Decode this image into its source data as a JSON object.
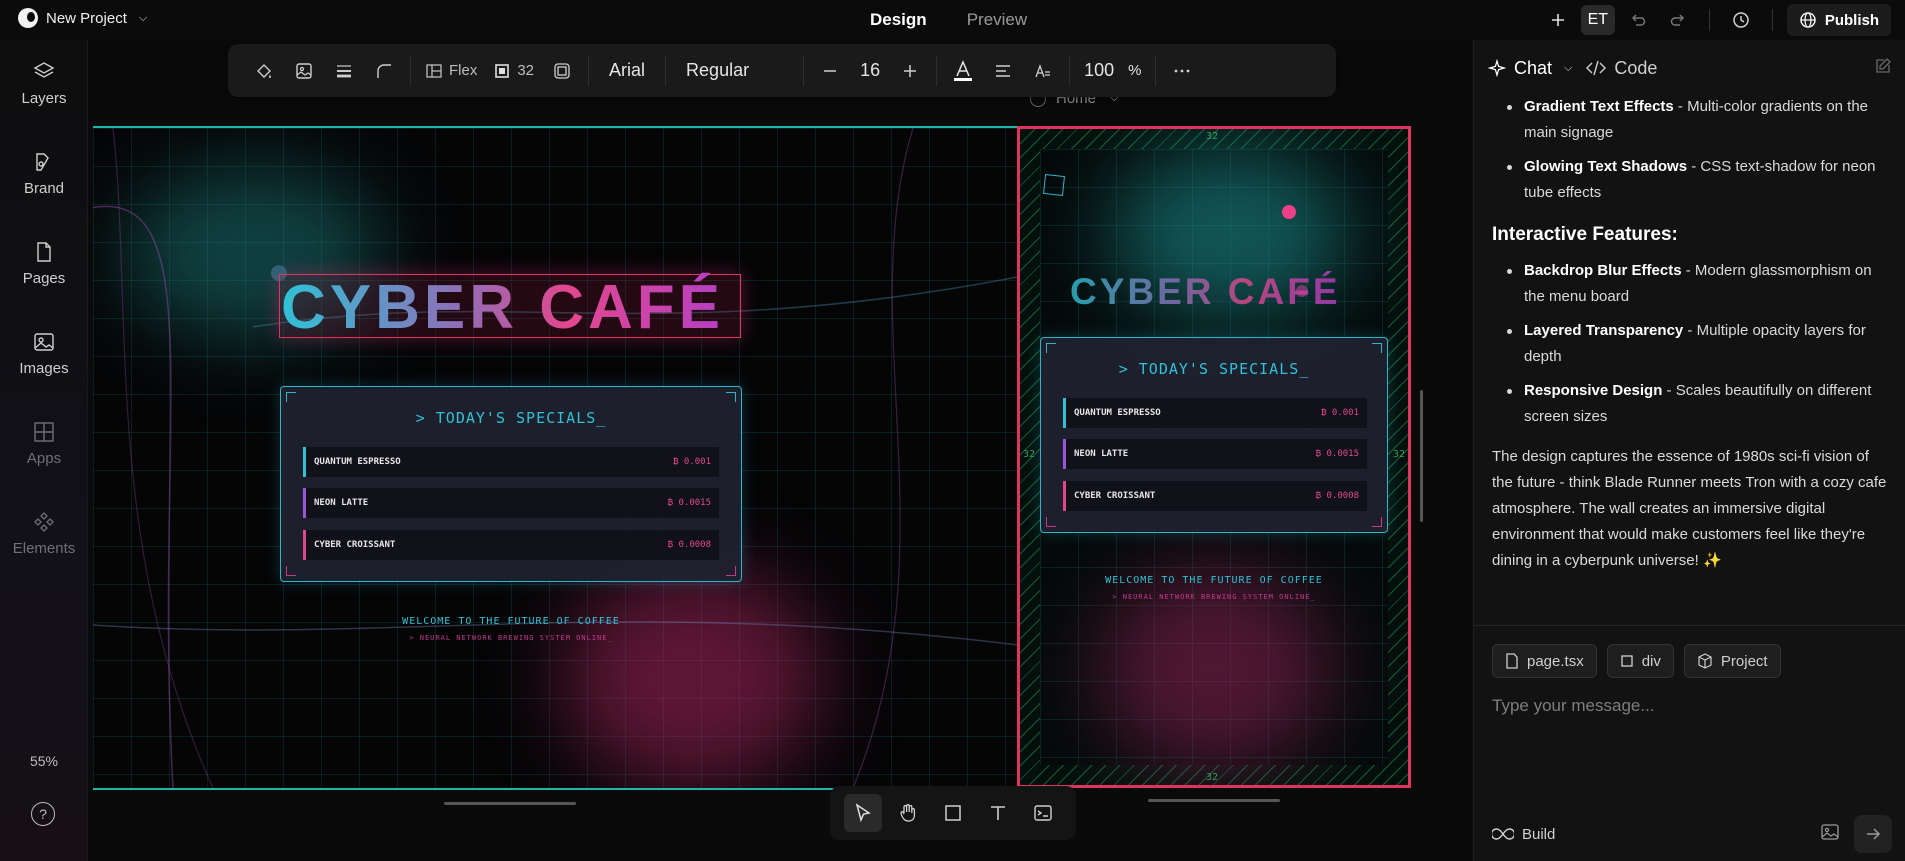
{
  "project": {
    "name": "New Project"
  },
  "modes": [
    {
      "label": "Design"
    },
    {
      "label": "Preview"
    }
  ],
  "top_right": {
    "avatar": "ET",
    "publish": "Publish"
  },
  "sidebar": {
    "items": [
      {
        "label": "Layers",
        "icon": "layers-icon"
      },
      {
        "label": "Brand",
        "icon": "brand-icon"
      },
      {
        "label": "Pages",
        "icon": "page-icon"
      },
      {
        "label": "Images",
        "icon": "image-icon"
      },
      {
        "label": "Apps",
        "icon": "apps-icon"
      },
      {
        "label": "Elements",
        "icon": "elements-icon"
      }
    ],
    "zoom": "55%"
  },
  "toolbar": {
    "layout": "Flex",
    "gap": "32",
    "font_family": "Arial",
    "font_weight": "Regular",
    "font_size": "16",
    "opacity": "100",
    "opacity_unit": "%"
  },
  "artboard": {
    "home_label": "Home",
    "title": "CYBER CAFÉ",
    "menu_heading": "> TODAY'S SPECIALS_",
    "menu_items": [
      {
        "name": "QUANTUM ESPRESSO",
        "price": "₿ 0.001",
        "accent": "#2fc2d6"
      },
      {
        "name": "NEON LATTE",
        "price": "₿ 0.0015",
        "accent": "#9b55d8"
      },
      {
        "name": "CYBER CROISSANT",
        "price": "₿ 0.0008",
        "accent": "#e0478e"
      }
    ],
    "welcome": "WELCOME TO THE FUTURE OF COFFEE",
    "tagline": "> NEURAL NETWORK BREWING SYSTEM ONLINE_",
    "gap_marker": "32"
  },
  "chat": {
    "tabs": [
      {
        "label": "Chat"
      },
      {
        "label": "Code"
      }
    ],
    "features_top": [
      {
        "title": "Gradient Text Effects",
        "desc": " - Multi-color gradients on the main signage"
      },
      {
        "title": "Glowing Text Shadows",
        "desc": " - CSS text-shadow for neon tube effects"
      }
    ],
    "interactive_heading": "Interactive Features:",
    "features": [
      {
        "title": "Backdrop Blur Effects",
        "desc": " - Modern glassmorphism on the menu board"
      },
      {
        "title": "Layered Transparency",
        "desc": " - Multiple opacity layers for depth"
      },
      {
        "title": "Responsive Design",
        "desc": " - Scales beautifully on different screen sizes"
      }
    ],
    "summary": "The design captures the essence of 1980s sci-fi vision of the future - think Blade Runner meets Tron with a cozy cafe atmosphere. The wall creates an immersive digital environment that would make customers feel like they're dining in a cyberpunk universe! ✨",
    "context_chips": [
      {
        "label": "page.tsx",
        "icon": "file-icon"
      },
      {
        "label": "div",
        "icon": "square-icon"
      },
      {
        "label": "Project",
        "icon": "box-icon"
      }
    ],
    "input_placeholder": "Type your message...",
    "build_label": "Build"
  },
  "colors": {
    "accent_teal": "#1fb5a8",
    "accent_pink": "#e0345f",
    "cyan": "#2fc2d6",
    "magenta": "#e0478e"
  }
}
